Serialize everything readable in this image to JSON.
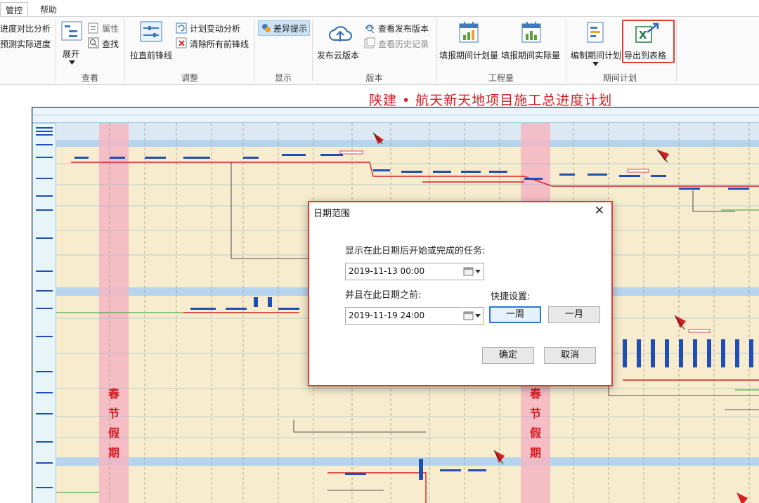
{
  "menu": {
    "tabs": [
      "管控",
      "帮助"
    ]
  },
  "ribbon": {
    "compare_top": "进度对比分析",
    "compare_bottom": "预测实际进度",
    "expand": "展开",
    "properties": "属性",
    "find": "查找",
    "group_view": "查看",
    "straighten_front": "拉直前锋线",
    "plan_change": "计划变动分析",
    "clear_front": "清除所有前锋线",
    "group_adjust": "调整",
    "diff_hint": "差异提示",
    "group_display": "显示",
    "publish_cloud": "发布云版本",
    "view_published": "查看发布版本",
    "view_history": "查看历史记录",
    "group_version": "版本",
    "fill_plan": "填报期间计划量",
    "fill_actual": "填报期间实际量",
    "group_quantity": "工程量",
    "edit_plan": "编制期间计划",
    "export_sheet": "导出到表格",
    "group_period": "期间计划"
  },
  "chart": {
    "title": "陕建 • 航天新天地项目施工总进度计划",
    "holiday_label": [
      "春",
      "节",
      "假",
      "期"
    ]
  },
  "dialog": {
    "title": "日期范围",
    "start_prompt": "显示在此日期后开始或完成的任务:",
    "start_value": "2019-11-13 00:00",
    "end_prompt": "并且在此日期之前:",
    "end_value": "2019-11-19 24:00",
    "quick_label": "快捷设置:",
    "week": "一周",
    "month": "一月",
    "ok": "确定",
    "cancel": "取消"
  },
  "colors": {
    "accent_red": "#d71920",
    "holiday_band": "#f4b6c2",
    "focus_blue": "#2b78d4"
  }
}
